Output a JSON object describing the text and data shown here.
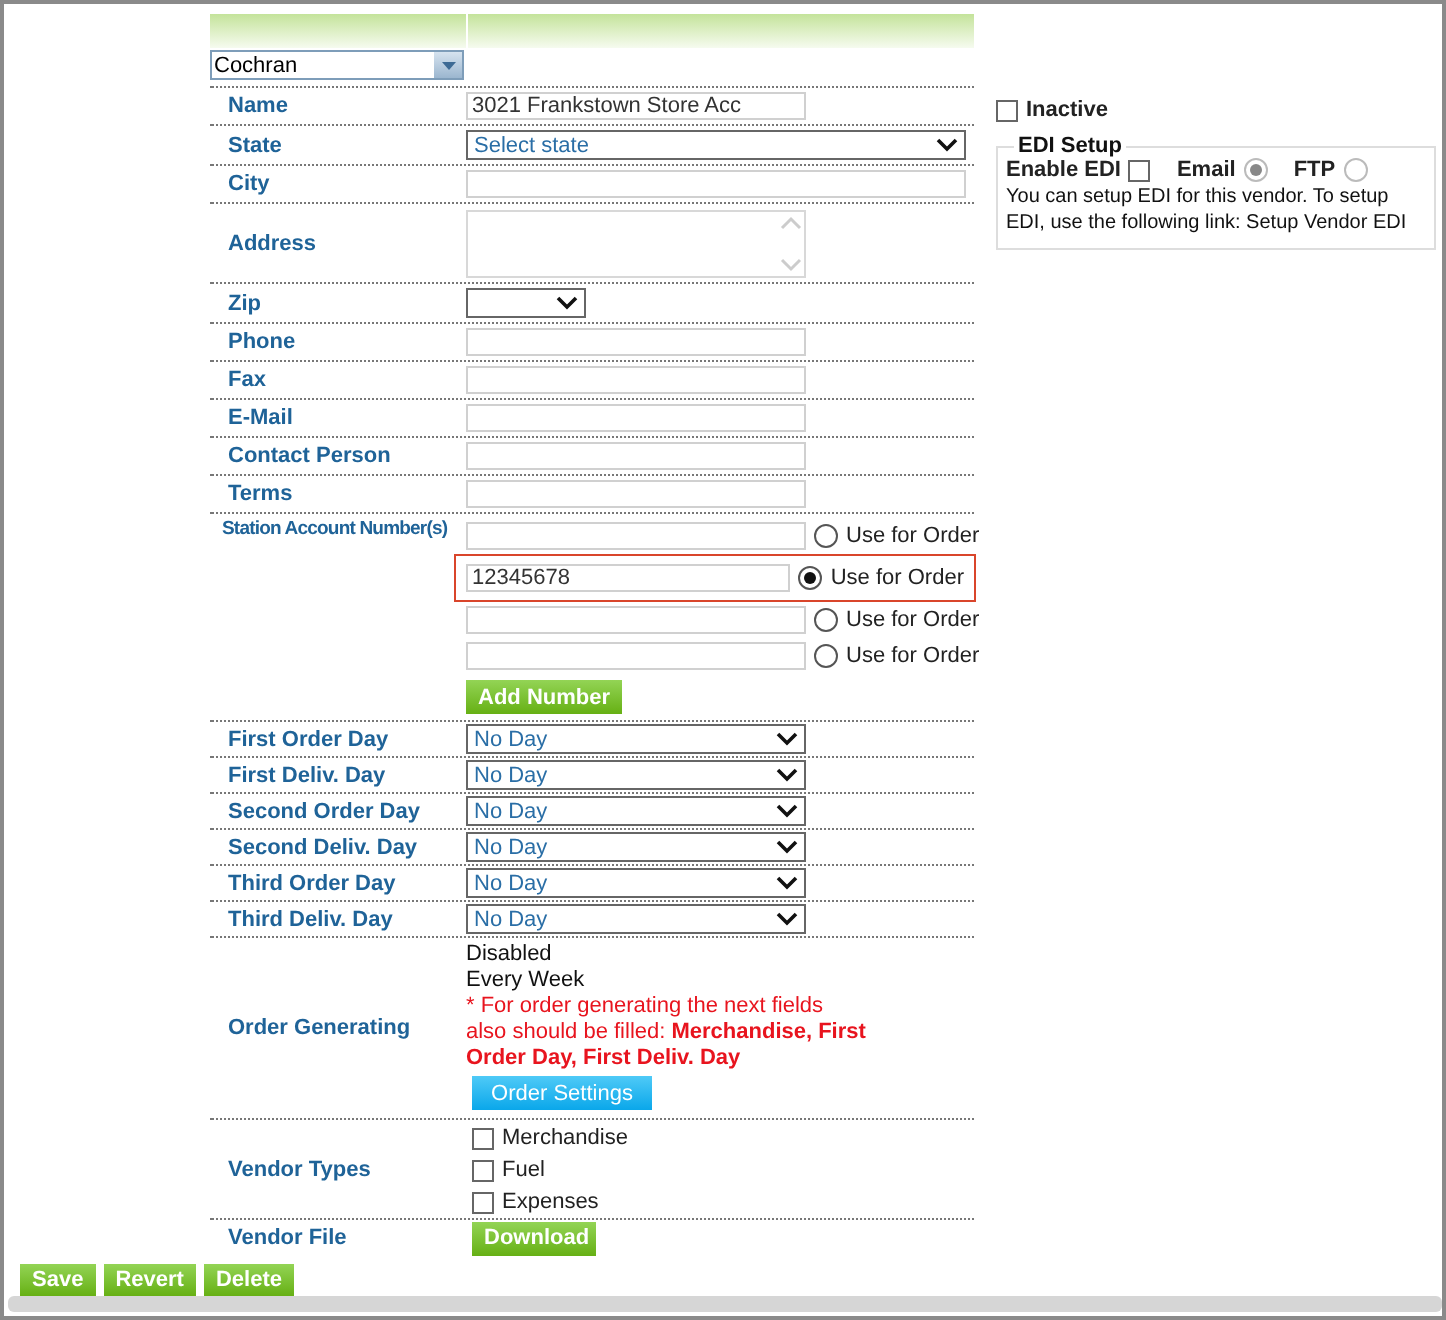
{
  "vendor_dropdown": {
    "value": "Cochran"
  },
  "fields": [
    {
      "kind": "input",
      "label": "Name",
      "value": "3021 Frankstown Store Acc"
    },
    {
      "kind": "wideselect",
      "label": "State",
      "value": "Select state"
    },
    {
      "kind": "wideinput",
      "label": "City"
    },
    {
      "kind": "textarea",
      "label": "Address"
    },
    {
      "kind": "smallselect",
      "label": "Zip"
    },
    {
      "kind": "input",
      "label": "Phone"
    },
    {
      "kind": "input",
      "label": "Fax"
    },
    {
      "kind": "input",
      "label": "E-Mail"
    },
    {
      "kind": "input",
      "label": "Contact Person"
    },
    {
      "kind": "input",
      "label": "Terms"
    }
  ],
  "station_accounts": {
    "label": "Station Account Number(s)",
    "add_button": "Add Number",
    "numbers": [
      {
        "option": "Use for Order",
        "selected": false,
        "highlighted": false
      },
      {
        "value": "12345678",
        "option": "Use for Order",
        "selected": true,
        "highlighted": true
      },
      {
        "option": "Use for Order",
        "selected": false,
        "highlighted": false
      },
      {
        "option": "Use for Order",
        "selected": false,
        "highlighted": false
      }
    ]
  },
  "days": [
    {
      "label": "First Order Day",
      "value": "No Day"
    },
    {
      "label": "First Deliv. Day",
      "value": "No Day"
    },
    {
      "label": "Second Order Day",
      "value": "No Day"
    },
    {
      "label": "Second Deliv. Day",
      "value": "No Day"
    },
    {
      "label": "Third Order Day",
      "value": "No Day"
    },
    {
      "label": "Third Deliv. Day",
      "value": "No Day"
    }
  ],
  "order_generating": {
    "label": "Order Generating",
    "lines": [
      "Disabled",
      "Every Week"
    ],
    "note": "* For order generating the next fields also should be filled: **Merchandise, First Order Day, First Deliv. Day**",
    "button": "Order Settings"
  },
  "vendor_types": {
    "label": "Vendor Types",
    "options": [
      {
        "label": "Merchandise",
        "checked": false
      },
      {
        "label": "Fuel",
        "checked": false
      },
      {
        "label": "Expenses",
        "checked": false
      }
    ]
  },
  "vendor_file": {
    "label": "Vendor File",
    "button": "Download"
  },
  "side": {
    "inactive": {
      "label": "Inactive",
      "checked": false
    },
    "edi": {
      "title": "EDI Setup",
      "enable": {
        "label": "Enable EDI",
        "checked": false
      },
      "methods": [
        {
          "label": "Email",
          "selected": true,
          "disabled": true
        },
        {
          "label": "FTP",
          "selected": false,
          "disabled": true
        }
      ],
      "text": "You can setup EDI for this vendor. To setup EDI, use the following link: Setup Vendor EDI"
    }
  },
  "actions": [
    "Save",
    "Revert",
    "Delete"
  ]
}
